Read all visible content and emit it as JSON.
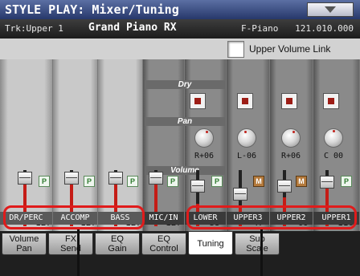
{
  "title": "STYLE PLAY: Mixer/Tuning",
  "track_bar": {
    "track_label": "Trk:Upper 1",
    "sound_name": "Grand Piano RX",
    "sound_bank": "F-Piano",
    "sound_code": "121.010.000"
  },
  "upper_volume_link_label": "Upper Volume Link",
  "sections": {
    "dry": "Dry",
    "pan": "Pan",
    "volume": "Volume"
  },
  "channels": [
    {
      "name": "DR/PERC",
      "volume": "127"
    },
    {
      "name": "ACCOMP",
      "volume": "127"
    },
    {
      "name": "BASS",
      "volume": "127"
    },
    {
      "name": "MIC/IN",
      "volume": "127"
    },
    {
      "name": "LOWER",
      "volume": "55"
    },
    {
      "name": "UPPER3",
      "volume": "47",
      "pan": "L-06"
    },
    {
      "name": "UPPER2",
      "volume": "69",
      "pan": "R+06"
    },
    {
      "name": "UPPER1",
      "volume": "116",
      "pan": "C 00"
    }
  ],
  "lower_pan": "R+06",
  "buttons": {
    "play": "P",
    "mute": "M"
  },
  "tabs": [
    {
      "line1": "Volume",
      "line2": "Pan"
    },
    {
      "line1": "FX",
      "line2": "Send"
    },
    {
      "line1": "EQ",
      "line2": "Gain"
    },
    {
      "line1": "EQ",
      "line2": "Control"
    },
    {
      "line1": "Tuning",
      "line2": ""
    },
    {
      "line1": "Sub",
      "line2": "Scale"
    }
  ],
  "colors": {
    "title_bar": "#27386b",
    "highlight": "#e01b1b",
    "button_red": "#9c1d16",
    "mute_orange": "#b47a3c"
  }
}
